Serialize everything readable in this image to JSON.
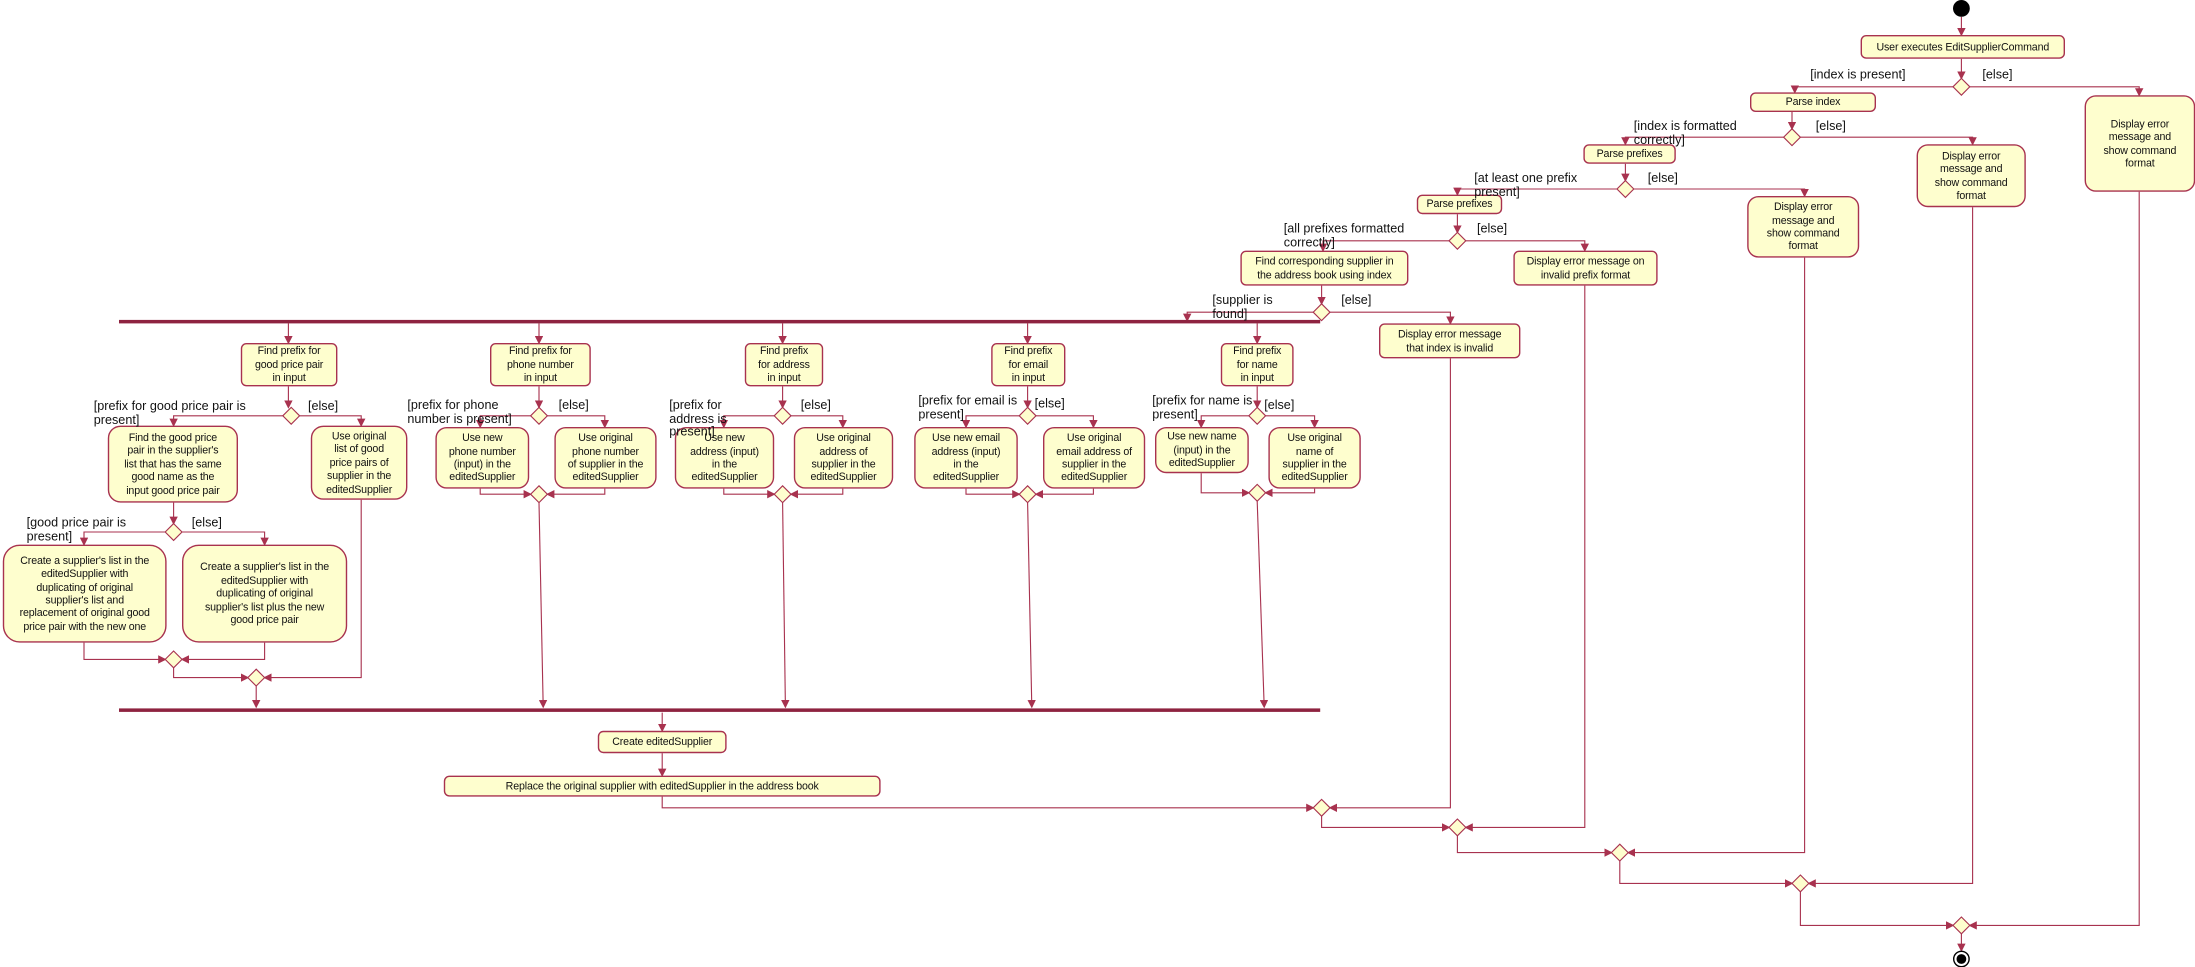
{
  "diagram": {
    "type": "uml-activity",
    "colors": {
      "node_fill": "#fefece",
      "border": "#a8324f",
      "line": "#a8324f",
      "bar": "#8e2340",
      "start": "#000000"
    }
  },
  "nodes": {
    "user_executes": {
      "lines": [
        "User executes  EditSupplierCommand"
      ]
    },
    "parse_index": {
      "lines": [
        "Parse index"
      ]
    },
    "err_format_1": {
      "lines": [
        "Display error",
        "message and",
        "show command",
        "format"
      ]
    },
    "parse_prefixes_1": {
      "lines": [
        "Parse prefixes"
      ]
    },
    "err_format_2": {
      "lines": [
        "Display error",
        "message and",
        "show command",
        "format"
      ]
    },
    "parse_prefixes_2": {
      "lines": [
        "Parse prefixes"
      ]
    },
    "err_format_3": {
      "lines": [
        "Display error",
        "message and",
        "show command",
        "format"
      ]
    },
    "find_supplier": {
      "lines": [
        "Find corresponding  supplier in",
        "the address book using index"
      ]
    },
    "err_prefix_format": {
      "lines": [
        "Display error message on",
        "invalid prefix format"
      ]
    },
    "err_index_invalid": {
      "lines": [
        "Display error message",
        "that index is invalid"
      ]
    },
    "find_prefix_gpp": {
      "lines": [
        "Find prefix for",
        "good price pair",
        "in input"
      ]
    },
    "find_gpp_in_list": {
      "lines": [
        "Find the good price",
        "pair in the supplier's",
        "list that has the same",
        "good name as the",
        "input good price pair"
      ]
    },
    "use_original_gpp": {
      "lines": [
        "Use original",
        "list of good",
        "price pairs of",
        "supplier in the",
        "editedSupplier"
      ]
    },
    "create_list_replace": {
      "lines": [
        "Create a supplier's list in the",
        "editedSupplier with",
        "duplicating of original",
        "supplier's list and",
        "replacement of original good",
        "price pair with the new one"
      ]
    },
    "create_list_plus": {
      "lines": [
        "Create a supplier's list in the",
        "editedSupplier with",
        "duplicating of original",
        "supplier's list plus the new",
        "good price pair"
      ]
    },
    "find_prefix_phone": {
      "lines": [
        "Find prefix for",
        "phone number",
        "in input"
      ]
    },
    "use_new_phone": {
      "lines": [
        "Use new",
        "phone number",
        "(input) in the",
        "editedSupplier"
      ]
    },
    "use_original_phone": {
      "lines": [
        "Use original",
        "phone number",
        "of supplier in the",
        "editedSupplier"
      ]
    },
    "find_prefix_address": {
      "lines": [
        "Find prefix",
        "for address",
        "in input"
      ]
    },
    "use_new_address": {
      "lines": [
        "Use new",
        "address (input)",
        "in the",
        "editedSupplier"
      ]
    },
    "use_original_address": {
      "lines": [
        "Use original",
        "address of",
        "supplier in the",
        "editedSupplier"
      ]
    },
    "find_prefix_email": {
      "lines": [
        "Find prefix",
        "for email",
        "in input"
      ]
    },
    "use_new_email": {
      "lines": [
        "Use new email",
        "address (input)",
        "in the",
        "editedSupplier"
      ]
    },
    "use_original_email": {
      "lines": [
        "Use original",
        "email address of",
        "supplier in the",
        "editedSupplier"
      ]
    },
    "find_prefix_name": {
      "lines": [
        "Find prefix",
        "for name",
        "in input"
      ]
    },
    "use_new_name": {
      "lines": [
        "Use new name",
        "(input) in the",
        "editedSupplier"
      ]
    },
    "use_original_name": {
      "lines": [
        "Use original",
        "name of",
        "supplier in the",
        "editedSupplier"
      ]
    },
    "create_edited_supplier": {
      "lines": [
        "Create editedSupplier"
      ]
    },
    "replace_supplier": {
      "lines": [
        "Replace the original supplier with editedSupplier in the address book"
      ]
    }
  },
  "guards": {
    "index_present": {
      "lines": [
        "[index is present]"
      ]
    },
    "else_1": {
      "lines": [
        "[else]"
      ]
    },
    "index_formatted": {
      "lines": [
        "[index is formatted",
        "correctly]"
      ]
    },
    "else_2": {
      "lines": [
        "[else]"
      ]
    },
    "prefix_present": {
      "lines": [
        "[at least one prefix",
        "present]"
      ]
    },
    "else_3": {
      "lines": [
        "[else]"
      ]
    },
    "prefixes_formatted": {
      "lines": [
        "[all prefixes formatted",
        "correctly]"
      ]
    },
    "else_4": {
      "lines": [
        "[else]"
      ]
    },
    "supplier_found": {
      "lines": [
        "[supplier is",
        "found]"
      ]
    },
    "else_5": {
      "lines": [
        "[else]"
      ]
    },
    "gpp_prefix_present": {
      "lines": [
        "[prefix for good price pair is",
        "present]"
      ]
    },
    "else_gpp": {
      "lines": [
        "[else]"
      ]
    },
    "gpp_present": {
      "lines": [
        "[good price pair is",
        "present]"
      ]
    },
    "else_gpp_2": {
      "lines": [
        "[else]"
      ]
    },
    "phone_present": {
      "lines": [
        "[prefix for phone",
        "number is present]"
      ]
    },
    "else_phone": {
      "lines": [
        "[else]"
      ]
    },
    "address_present": {
      "lines": [
        "[prefix for",
        "address is",
        "present]"
      ]
    },
    "else_address": {
      "lines": [
        "[else]"
      ]
    },
    "email_present": {
      "lines": [
        "[prefix for email is",
        "present]"
      ]
    },
    "else_email": {
      "lines": [
        "[else]"
      ]
    },
    "name_present": {
      "lines": [
        "[prefix for name is",
        "present]"
      ]
    },
    "else_name": {
      "lines": [
        "[else]"
      ]
    }
  }
}
